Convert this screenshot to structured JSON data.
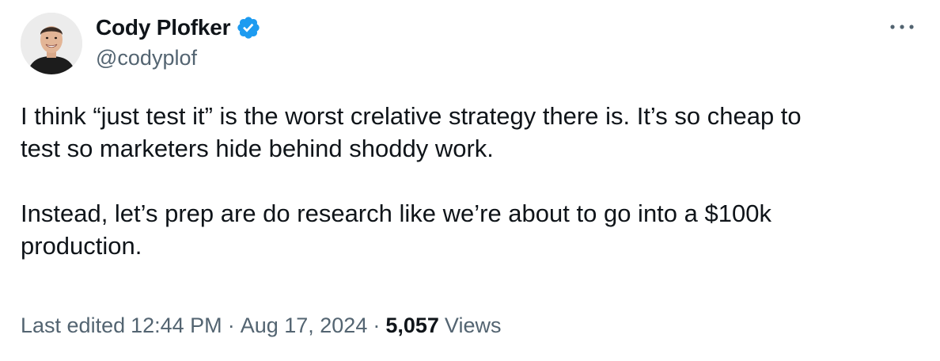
{
  "author": {
    "display_name": "Cody Plofker",
    "handle": "@codyplof",
    "verified": true,
    "verified_color": "#1d9bf0"
  },
  "menu": {
    "icon": "more-horizontal-icon"
  },
  "tweet": {
    "paragraphs": [
      {
        "lines": [
          "I think “just test it” is the worst crelative strategy there is. It’s so cheap to",
          "test so marketers hide behind shoddy work."
        ]
      },
      {
        "lines": [
          "Instead, let’s prep are do research like we’re about to go into a $100k",
          "production."
        ]
      }
    ]
  },
  "meta": {
    "edited_label": "Last edited",
    "time": "12:44 PM",
    "separator": "·",
    "date": "Aug 17, 2024",
    "views_count": "5,057",
    "views_label": "Views"
  },
  "colors": {
    "text_primary": "#0f1419",
    "text_secondary": "#536471",
    "background": "#ffffff"
  }
}
